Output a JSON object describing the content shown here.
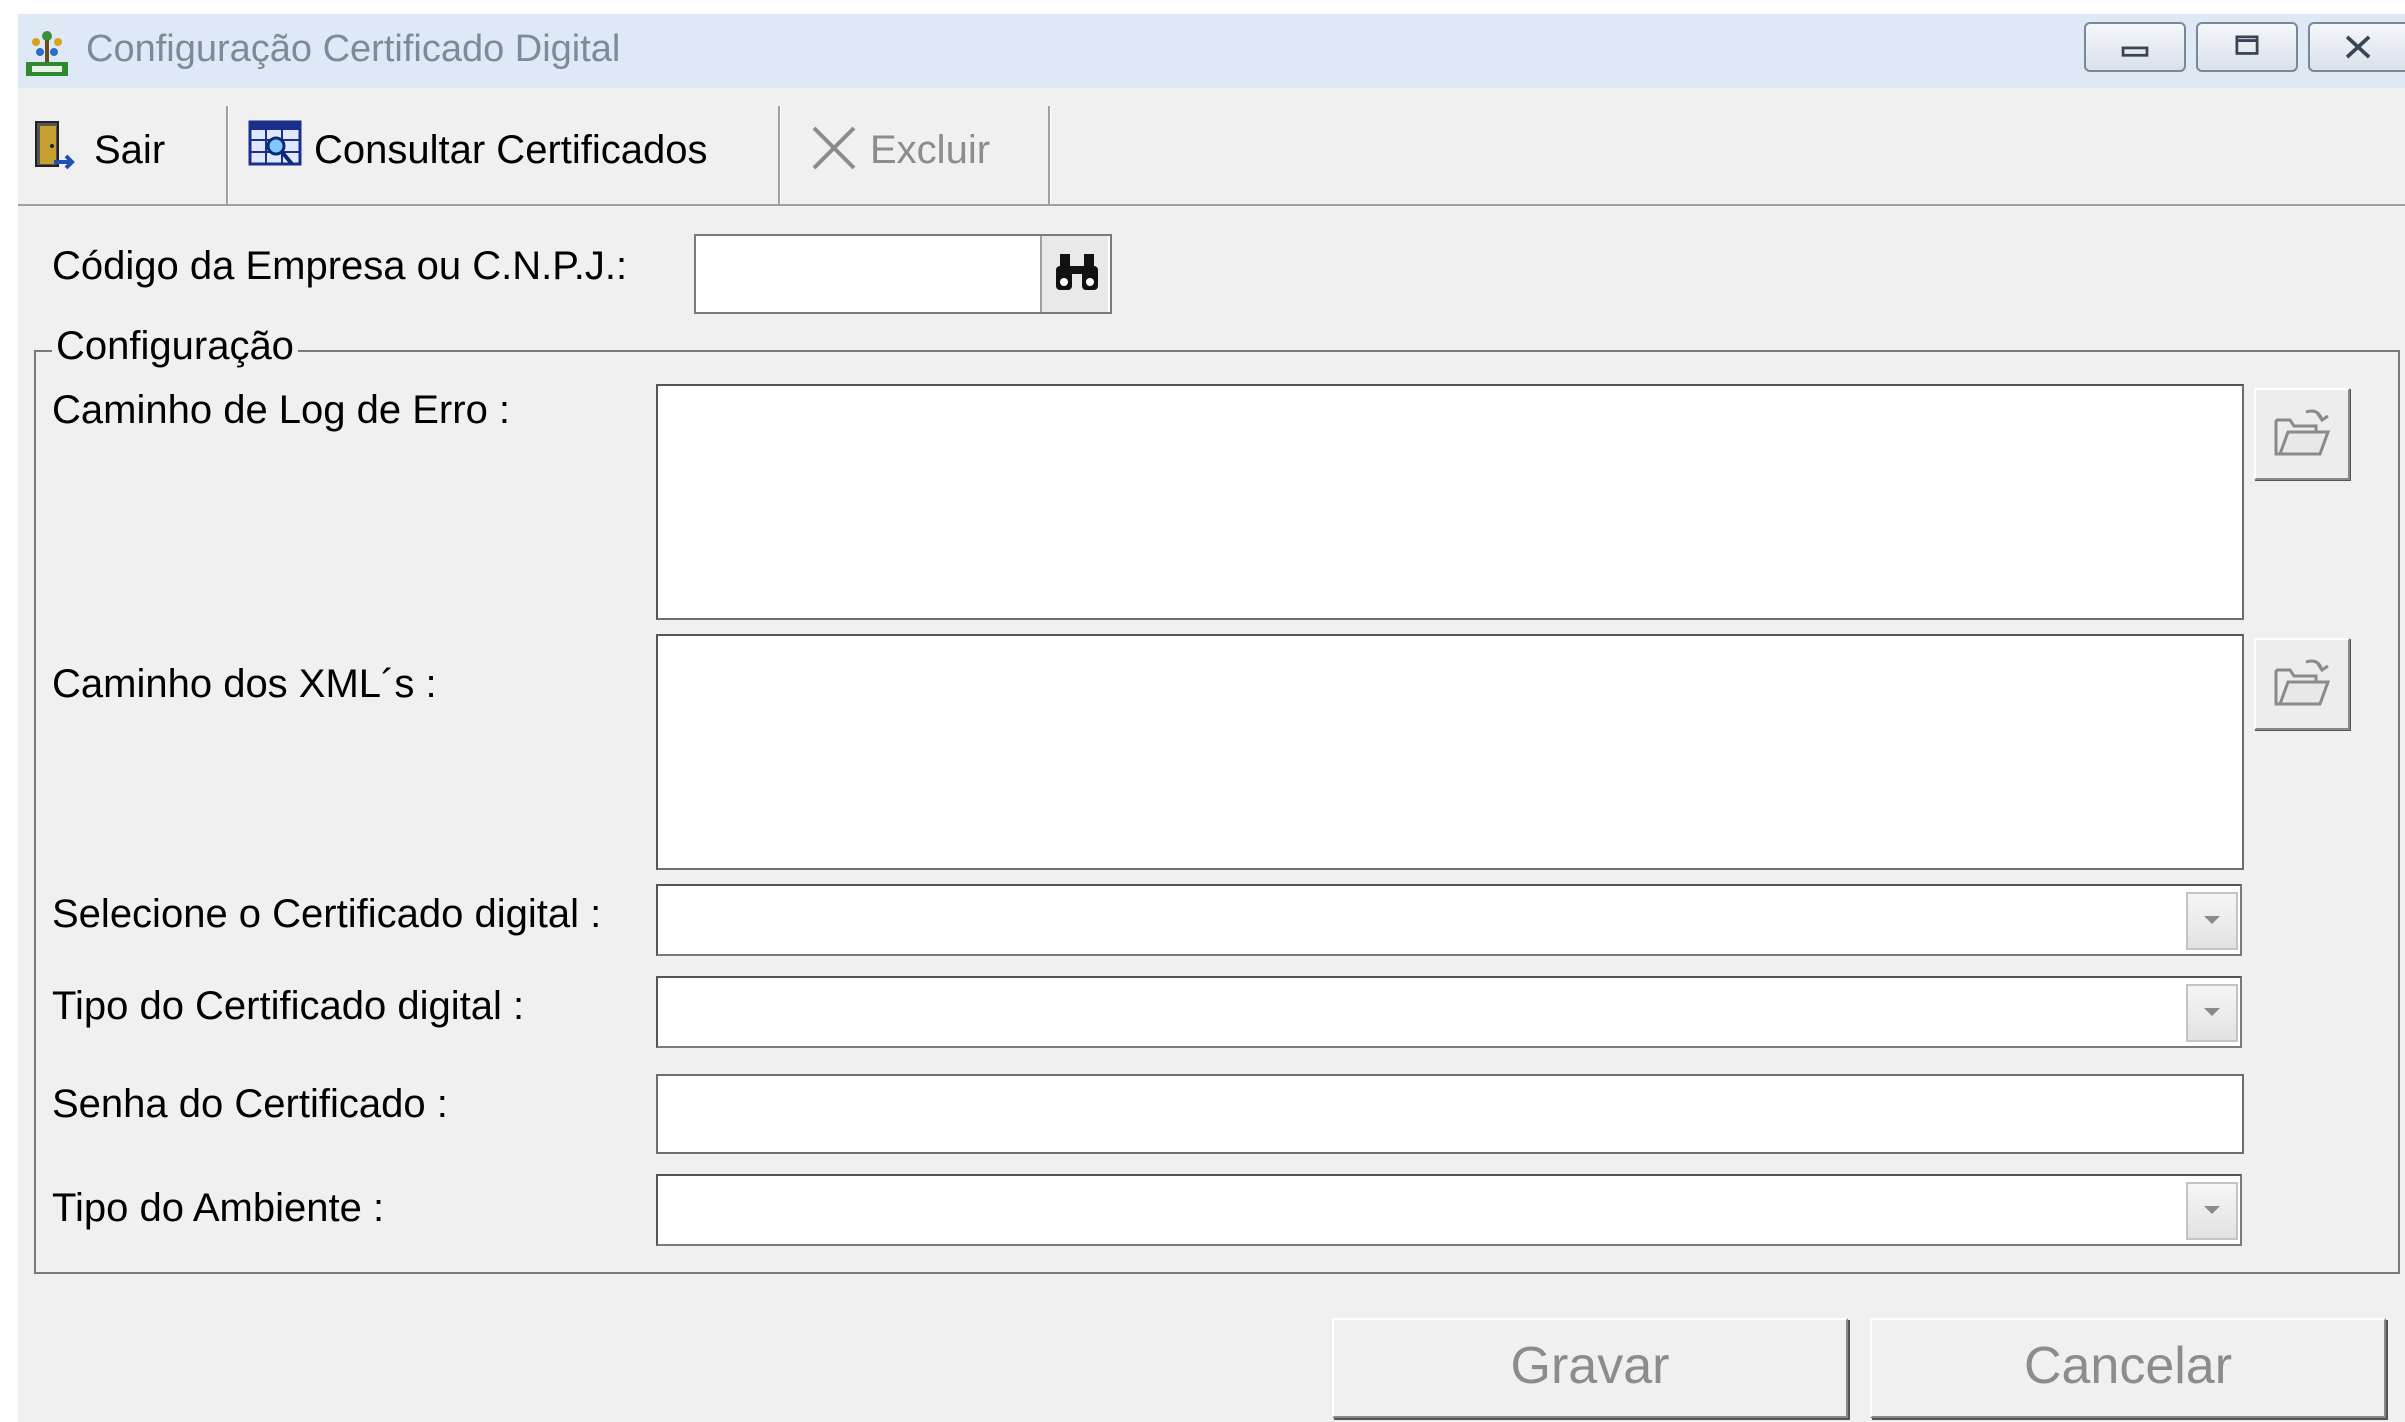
{
  "window": {
    "title": "Configuração Certificado Digital",
    "controls": [
      "minimize",
      "maximize",
      "close"
    ]
  },
  "toolbar": {
    "sair": "Sair",
    "consultar": "Consultar Certificados",
    "excluir": "Excluir"
  },
  "search": {
    "label": "Código da Empresa ou C.N.P.J.:",
    "value": ""
  },
  "config": {
    "legend": "Configuração",
    "log_label": "Caminho de Log de Erro :",
    "xml_label": "Caminho dos XML´s :",
    "cert_label": "Selecione o Certificado digital :",
    "tipo_cert_label": "Tipo do Certificado digital :",
    "senha_label": "Senha do Certificado :",
    "ambiente_label": "Tipo do Ambiente :"
  },
  "buttons": {
    "gravar": "Gravar",
    "cancelar": "Cancelar"
  },
  "icons": {
    "app": "app-tree-icon",
    "sair": "exit-door-icon",
    "consultar": "grid-search-icon",
    "excluir": "x-delete-icon",
    "search": "binoculars-icon",
    "browse": "open-folder-icon",
    "dropdown": "chevron-down-icon"
  }
}
